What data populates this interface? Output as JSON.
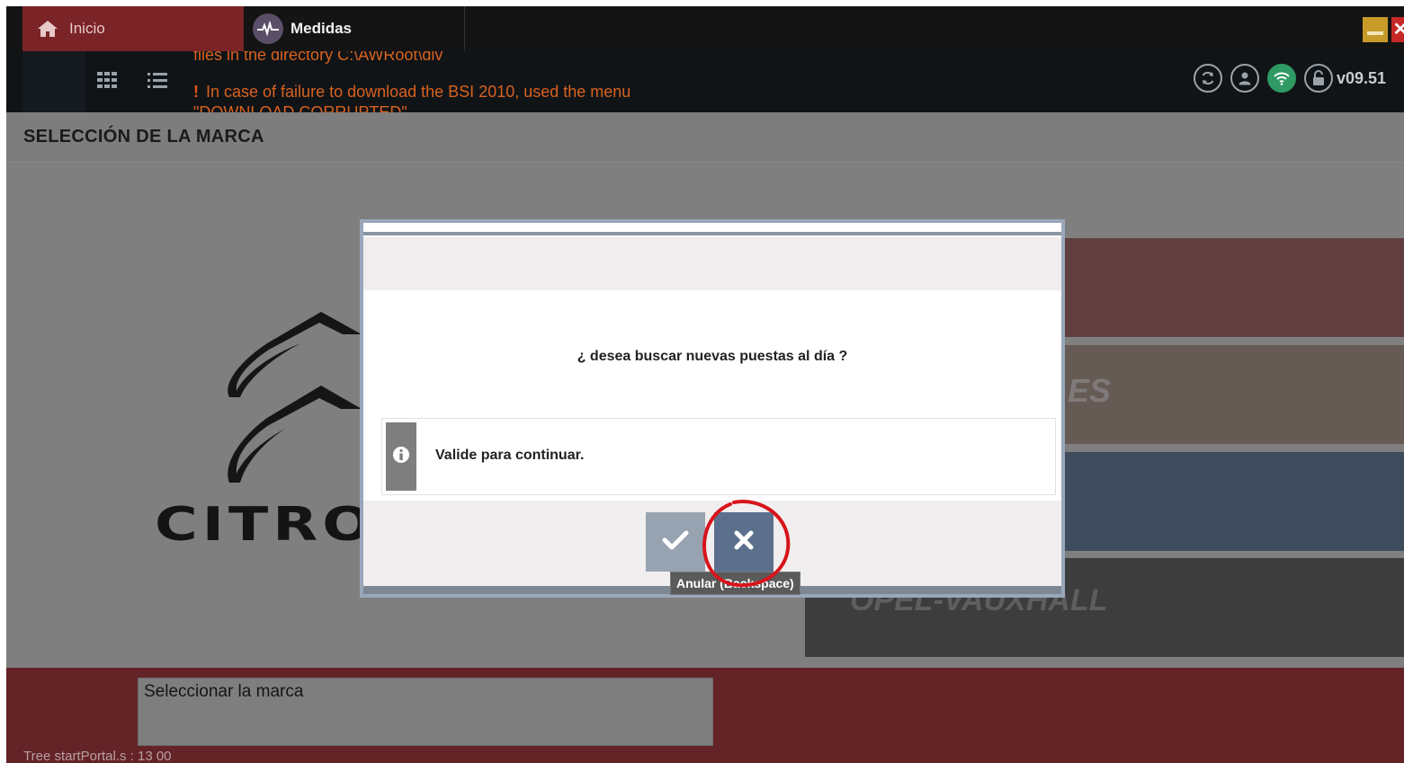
{
  "tabs": {
    "home_label": "Inicio",
    "measures_label": "Medidas"
  },
  "toolbar": {
    "message_top": "files in the directory C:\\AWRoot\\dlv",
    "message_icon": "!",
    "message_main": "In case of failure to download the BSI 2010, used the menu",
    "message_bottom": "\"DOWNLOAD CORRUPTED\"",
    "version": "v09.51",
    "status_icons": [
      "refresh-icon",
      "user-icon",
      "wifi-icon",
      "lock-icon"
    ]
  },
  "page": {
    "title": "SELECCIÓN DE LA MARCA"
  },
  "brands": {
    "citroen_word": "CITRO",
    "tile2_text": "ES",
    "tile4_text": "OPEL-VAUXHALL"
  },
  "dialog": {
    "question": "¿ desea buscar nuevas puestas al día ?",
    "info_text": "Valide para continuar.",
    "tooltip": "Anular (Backspace)"
  },
  "footer": {
    "hint": "Seleccionar la marca",
    "tree": "Tree startPortal.s : 13 00"
  },
  "colors": {
    "accent_red": "#7a2428",
    "toolbar_text_orange": "#d9621f",
    "wifi_green": "#2f9a63",
    "cancel_blue": "#5c708d",
    "highlight_red": "#d8141c"
  }
}
